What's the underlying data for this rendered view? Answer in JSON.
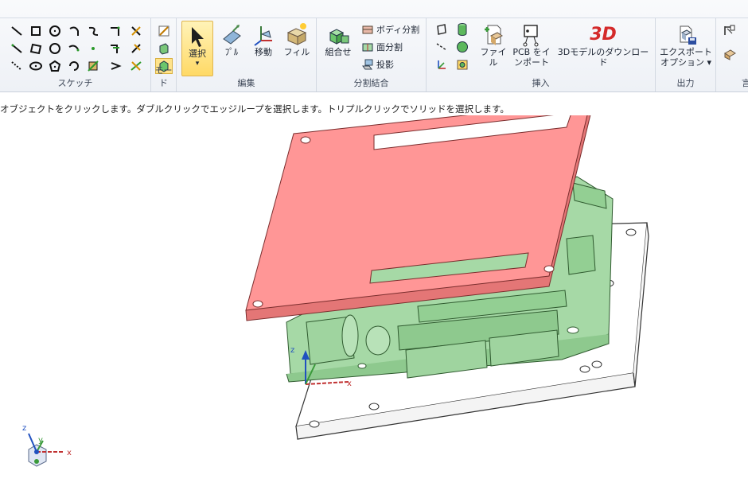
{
  "ribbon": {
    "groups": {
      "sketch": "スケッチ",
      "mode": "モード",
      "edit": "編集",
      "split_combine": "分割結合",
      "insert": "挿入",
      "output": "出力",
      "partial_next": "言"
    },
    "edit_buttons": {
      "select": "選択",
      "select_arrow": "▾",
      "pull": "ﾌﾟﾙ",
      "move": "移動",
      "fill": "フィル"
    },
    "split_buttons": {
      "combine": "組合せ",
      "split_body": "ボディ分割",
      "split_face": "面分割",
      "project": "投影"
    },
    "insert_buttons": {
      "file": "ファイル",
      "pcb_import_line1": "PCB をイ",
      "pcb_import_line2": "ンポート",
      "model_3d_badge": "3D",
      "model_3d_download": "3Dモデルのダウンロード"
    },
    "output_buttons": {
      "export_line1": "エクスポート",
      "export_line2": "オプション ▾"
    }
  },
  "status_bar": {
    "hint": "オブジェクトをクリックします。ダブルクリックでエッジループを選択します。トリプルクリックでソリッドを選択します。"
  },
  "viewport": {
    "axis_labels": {
      "x": "x",
      "y": "y",
      "z": "z"
    },
    "colors": {
      "top_plate": "#ff9696",
      "pcb_green": "#a6d9a6",
      "base_plate": "#ffffff",
      "edge": "#333333"
    }
  }
}
